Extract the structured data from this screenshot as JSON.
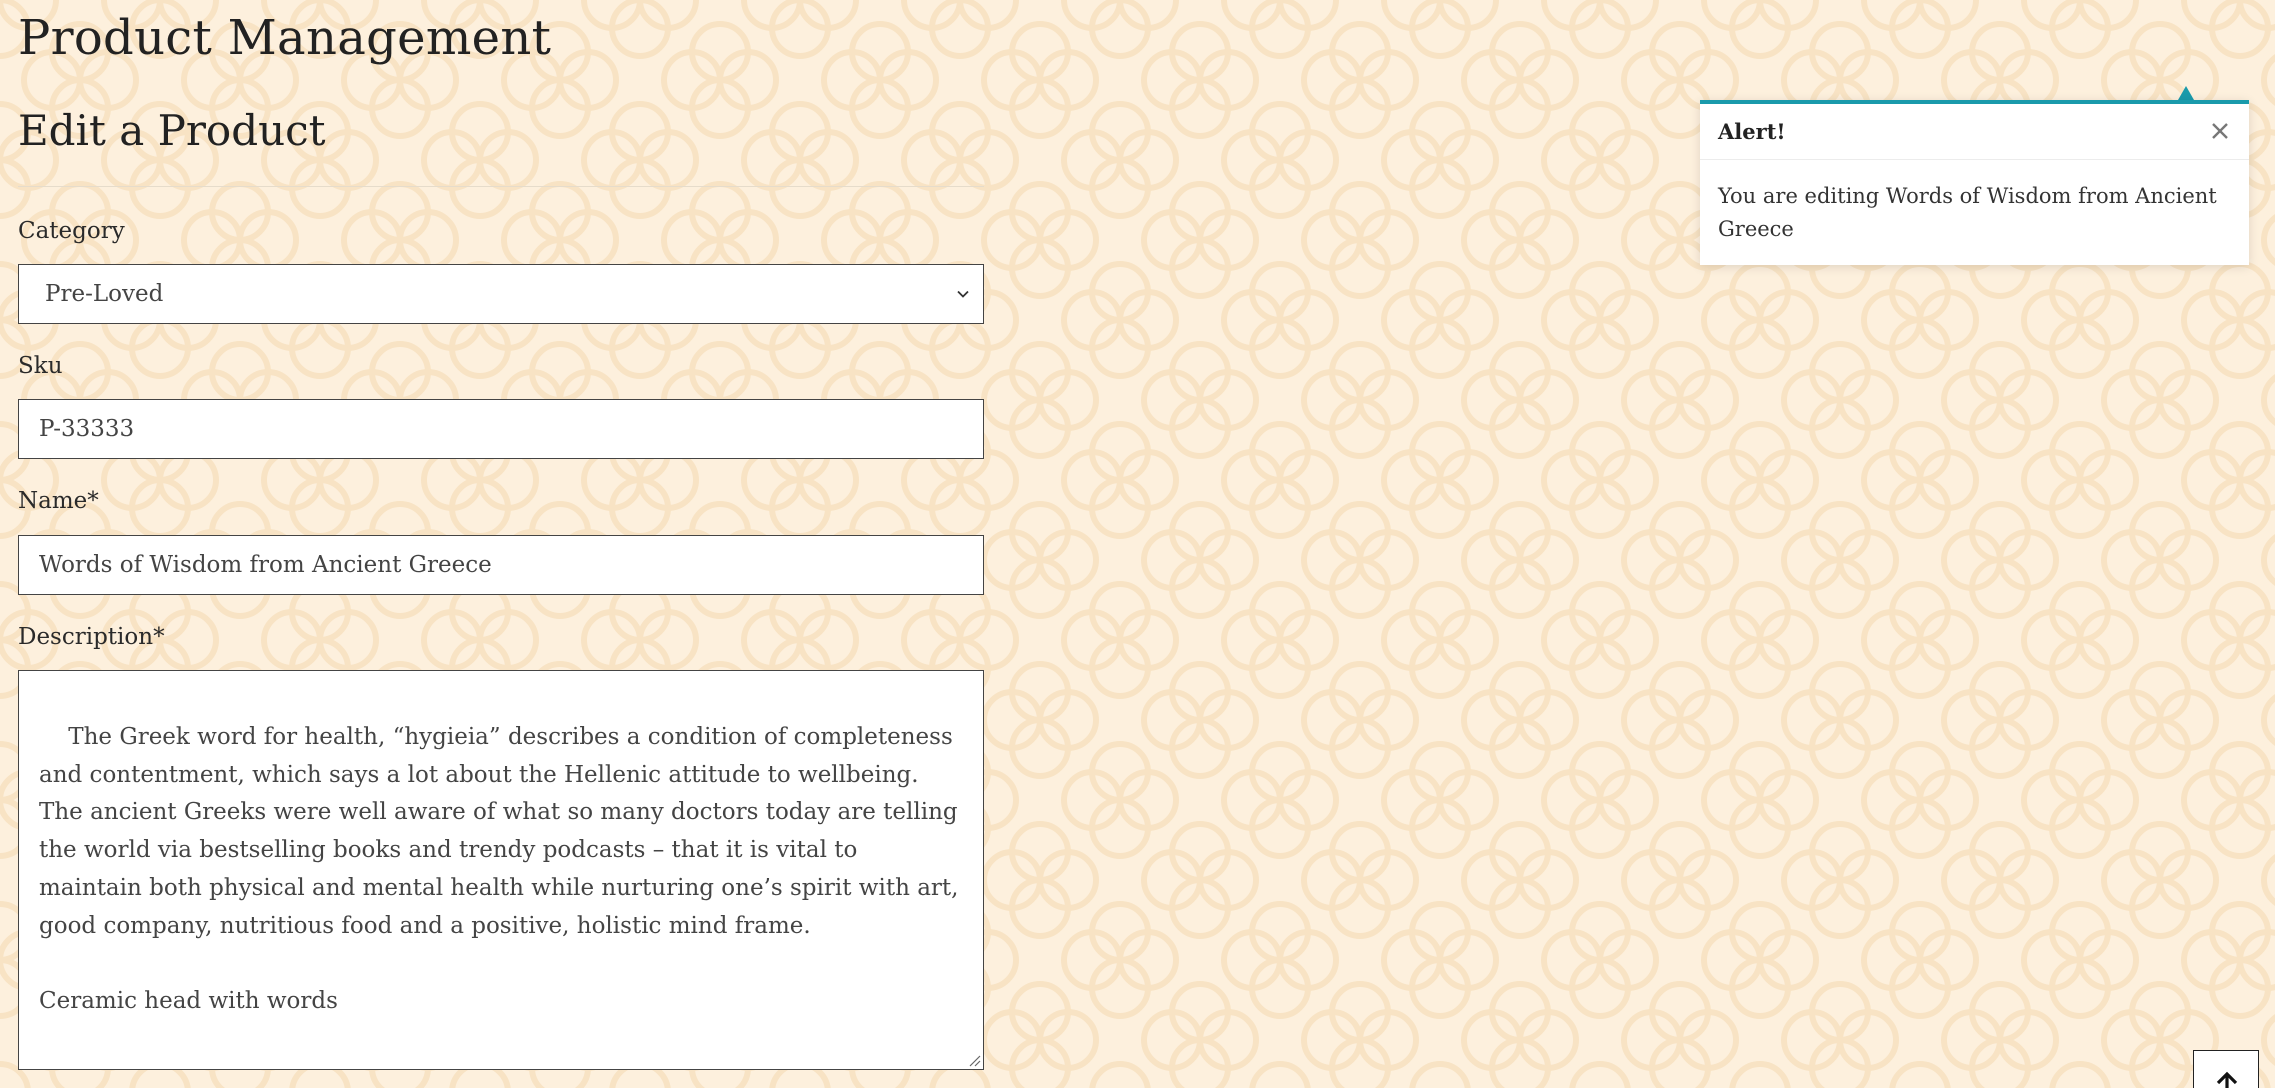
{
  "page": {
    "title": "Product Management"
  },
  "form": {
    "title": "Edit a Product",
    "category": {
      "label": "Category",
      "selected": "Pre-Loved"
    },
    "sku": {
      "label": "Sku",
      "value": "P-33333"
    },
    "name": {
      "label": "Name*",
      "value": "Words of Wisdom from Ancient Greece"
    },
    "description": {
      "label": "Description*",
      "value": "The Greek word for health, “hygieia” describes a condition of completeness and contentment, which says a lot about the Hellenic attitude to wellbeing. The ancient Greeks were well aware of what so many doctors today are telling the world via bestselling books and trendy podcasts – that it is vital to maintain both physical and mental health while nurturing one’s spirit with art, good company, nutritious food and a positive, holistic mind frame.\n\nCeramic head with words"
    }
  },
  "alert": {
    "title": "Alert!",
    "message": "You are editing Words of Wisdom from Ancient Greece",
    "accent_color": "#1a9aab",
    "close_icon": "close-icon"
  },
  "scroll_top": {
    "icon": "arrow-up-icon"
  },
  "colors": {
    "background": "#fdf0dd",
    "pattern": "#f8e3c4",
    "accent": "#1a9aab"
  }
}
